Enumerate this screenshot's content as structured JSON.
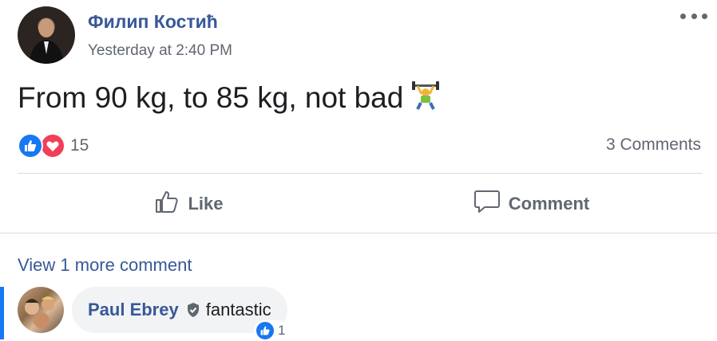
{
  "post": {
    "author": "Филип Костић",
    "timestamp": "Yesterday at 2:40 PM",
    "text": "From 90 kg, to 85 kg, not bad",
    "emoji": "weightlifter-icon",
    "reaction_count": "15",
    "comments_count": "3 Comments"
  },
  "actions": {
    "like": "Like",
    "comment": "Comment"
  },
  "comments": {
    "view_more": "View 1 more comment",
    "items": [
      {
        "author": "Paul Ebrey",
        "text": "fantastic",
        "reaction_count": "1"
      }
    ]
  },
  "colors": {
    "link": "#385898",
    "like_blue": "#1877f2",
    "love_red": "#f33e58",
    "muted": "#606770"
  }
}
